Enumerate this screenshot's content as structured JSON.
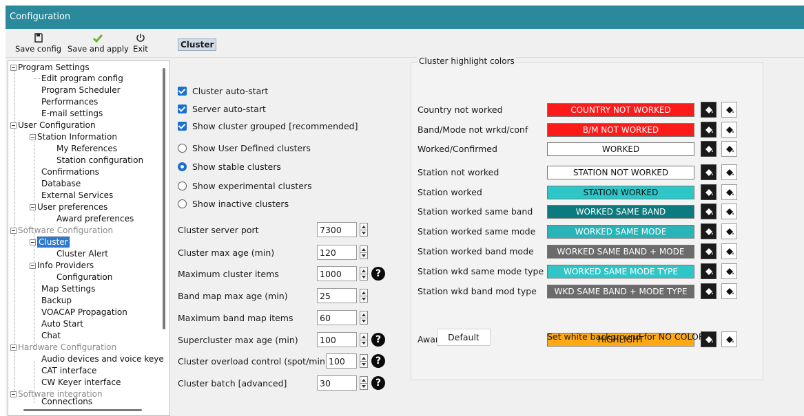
{
  "window": {
    "title": "Configuration"
  },
  "toolbar": {
    "save_config": "Save config",
    "save_apply": "Save and apply",
    "exit": "Exit"
  },
  "tree": {
    "program_settings": "Program Settings",
    "edit_program_config": "Edit program config",
    "program_scheduler": "Program Scheduler",
    "performances": "Performances",
    "email_settings": "E-mail settings",
    "user_configuration": "User Configuration",
    "station_information": "Station Information",
    "my_references": "My References",
    "station_configuration": "Station configuration",
    "confirmations": "Confirmations",
    "database": "Database",
    "external_services": "External Services",
    "user_preferences": "User preferences",
    "award_preferences": "Award preferences",
    "software_configuration": "Software Configuration",
    "cluster": "Cluster",
    "cluster_alert": "Cluster Alert",
    "info_providers": "Info Providers",
    "configuration": "Configuration",
    "map_settings": "Map Settings",
    "backup": "Backup",
    "voacap": "VOACAP Propagation",
    "auto_start": "Auto Start",
    "chat": "Chat",
    "hardware_configuration": "Hardware Configuration",
    "audio_devices": "Audio devices and voice keye",
    "cat_interface": "CAT interface",
    "cw_keyer": "CW Keyer interface",
    "software_integration": "Software integration",
    "connections": "Connections"
  },
  "cluster": {
    "title": "Cluster",
    "checkboxes": {
      "auto_start": "Cluster auto-start",
      "server_auto_start": "Server auto-start",
      "show_grouped": "Show cluster grouped [recommended]"
    },
    "radios": {
      "user_defined": "Show User Defined clusters",
      "stable": "Show stable clusters",
      "experimental": "Show experimental clusters",
      "inactive": "Show inactive clusters"
    },
    "fields": {
      "server_port": {
        "label": "Cluster server port",
        "value": "7300"
      },
      "max_age": {
        "label": "Cluster max age (min)",
        "value": "120"
      },
      "max_items": {
        "label": "Maximum cluster items",
        "value": "1000"
      },
      "band_map_age": {
        "label": "Band map max age (min)",
        "value": "25"
      },
      "band_map_items": {
        "label": "Maximum band map items",
        "value": "60"
      },
      "supercluster_age": {
        "label": "Supercluster max age (min)",
        "value": "100"
      },
      "overload": {
        "label": "Cluster overload control (spot/min)",
        "value": "100"
      },
      "batch": {
        "label": "Cluster batch [advanced]",
        "value": "30"
      }
    },
    "help_glyph": "?"
  },
  "highlight": {
    "title": "Cluster highlight colors",
    "rows": {
      "country": {
        "label": "Country not worked",
        "chip": "COUNTRY NOT WORKED",
        "bg": "#ff1a1a",
        "fg": "#ffffff"
      },
      "band_mode": {
        "label": "Band/Mode not wrkd/conf",
        "chip": "B/M NOT WORKED",
        "bg": "#ff1a1a",
        "fg": "#ffffff"
      },
      "worked": {
        "label": "Worked/Confirmed",
        "chip": "WORKED",
        "bg": "#ffffff",
        "fg": "#111111"
      },
      "station_not": {
        "label": "Station not worked",
        "chip": "STATION NOT WORKED",
        "bg": "#ffffff",
        "fg": "#111111"
      },
      "station_worked": {
        "label": "Station worked",
        "chip": "STATION WORKED",
        "bg": "#2ec6c6",
        "fg": "#111111"
      },
      "same_band": {
        "label": "Station worked same band",
        "chip": "WORKED SAME BAND",
        "bg": "#0c7b80",
        "fg": "#ffffff"
      },
      "same_mode": {
        "label": "Station worked same mode",
        "chip": "WORKED SAME MODE",
        "bg": "#2ab4b8",
        "fg": "#ffffff"
      },
      "band_mode_worked": {
        "label": "Station worked band mode",
        "chip": "WORKED SAME BAND + MODE",
        "bg": "#6b6b6b",
        "fg": "#ffffff"
      },
      "mode_type": {
        "label": "Station wkd same mode type",
        "chip": "WORKED SAME MODE TYPE",
        "bg": "#2ec6c6",
        "fg": "#ffffff"
      },
      "band_mod_type": {
        "label": "Station wkd band mod type",
        "chip": "WKD SAME BAND + MODE TYPE",
        "bg": "#6b6b6b",
        "fg": "#ffffff"
      },
      "award": {
        "label": "Award highlight",
        "chip": "HIGHLIGHT",
        "bg": "#ffaa14",
        "fg": "#111111"
      }
    },
    "default_button": "Default",
    "hint": "Set white background for NO COLOR"
  }
}
